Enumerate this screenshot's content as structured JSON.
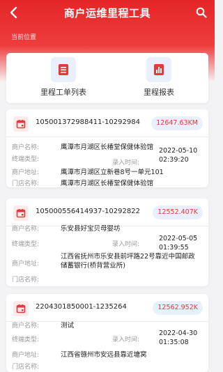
{
  "header": {
    "title": "商户运维里程工具",
    "location_label": "当前位置",
    "colors": {
      "primary": "#e42627",
      "accent_blue": "#5b7fd6",
      "badge_text": "#e2393a"
    }
  },
  "entries": [
    {
      "label": "里程工单列表",
      "icon": "list-icon"
    },
    {
      "label": "里程报表",
      "icon": "bar-chart-icon"
    }
  ],
  "field_labels": {
    "merchant_name": "商户名称:",
    "terminal_type": "终端类型:",
    "record_time": "录入时间:",
    "merchant_address": "商户地址:",
    "store_name": "门店名称:"
  },
  "records": [
    {
      "id": "105001372988411-10292984",
      "distance": "12647.63KM",
      "merchant_name": "鹰潭市月湖区长椿堂保健体验馆",
      "terminal_type": "",
      "record_time": "2022-05-10 02:39:20",
      "merchant_address": "鹰潭市月湖区立新巷8号一单元101",
      "store_name": "鹰潭市月湖区长椿堂保健体验馆"
    },
    {
      "id": "105000556414937-10292822",
      "distance": "12552.407K",
      "merchant_name": "乐安县好宝贝母婴坊",
      "terminal_type": "",
      "record_time": "2022-05-05 01:39:55",
      "merchant_address": "江西省抚州市乐安县前坪路22号靠近中国邮政储蓄银行(桥背营业所)",
      "store_name": ""
    },
    {
      "id": "2204301850001-1235264",
      "distance": "12562.952K",
      "merchant_name": "测试",
      "terminal_type": "",
      "record_time": "2022-04-30 01:35:08",
      "merchant_address": "江西省赣州市安远县靠近塘窝",
      "store_name": ""
    }
  ]
}
